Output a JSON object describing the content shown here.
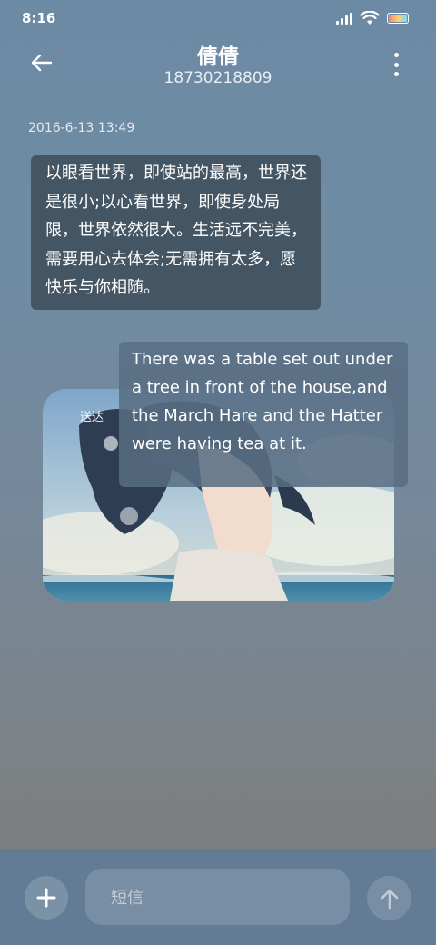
{
  "status_bar": {
    "time": "8:16",
    "icons": [
      "signal-icon",
      "wifi-icon",
      "battery-icon"
    ],
    "battery_colors": [
      "#ff7a7a",
      "#ffd36b",
      "#7fd8ff"
    ]
  },
  "header": {
    "contact_name": "倩倩",
    "contact_number": "18730218809",
    "back_icon": "back-arrow-icon",
    "more_icon": "more-vertical-icon"
  },
  "conversation": {
    "timestamp": "2016-6-13 13:49",
    "incoming_message": "以眼看世界，即使站的最高，世界还是很小;以心看世界，即使身处局限，世界依然很大。生活远不完美，需要用心去体会;无需拥有太多，愿快乐与你相随。",
    "outgoing_message": "There was a table set out under a tree in front of the house,and the March Hare and the Hatter were having tea at it.",
    "delivery_status": "送达"
  },
  "composer": {
    "placeholder": "短信",
    "add_icon": "plus-icon",
    "send_icon": "send-arrow-icon"
  },
  "colors": {
    "bottom_bar": "#627c95",
    "incoming_bubble": "#3f4d5a",
    "outgoing_bubble": "#586e82"
  }
}
